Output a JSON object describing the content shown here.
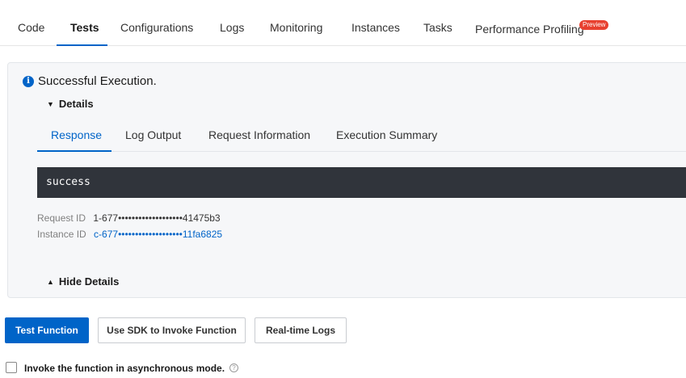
{
  "top_tabs": {
    "items": [
      "Code",
      "Tests",
      "Configurations",
      "Logs",
      "Monitoring",
      "Instances",
      "Tasks",
      "Performance Profiling"
    ],
    "active": "Tests",
    "preview_badge": "Preview"
  },
  "result": {
    "title": "Successful Execution.",
    "details_label": "Details",
    "sub_tabs": [
      "Response",
      "Log Output",
      "Request Information",
      "Execution Summary"
    ],
    "active_sub_tab": "Response",
    "response_body": "success",
    "request_id_label": "Request ID",
    "request_id_value": "1-677•••••••••••••••••••41475b3",
    "instance_id_label": "Instance ID",
    "instance_id_value": "c-677•••••••••••••••••••11fa6825",
    "hide_details_label": "Hide Details"
  },
  "actions": {
    "test_function": "Test Function",
    "sdk_invoke": "Use SDK to Invoke Function",
    "realtime_logs": "Real-time Logs"
  },
  "async": {
    "label": "Invoke the function in asynchronous mode.",
    "checked": false
  },
  "icons": {
    "info": "info-circle-icon",
    "caret_down": "caret-down-icon",
    "caret_up": "caret-up-icon",
    "help": "question-circle-icon"
  },
  "colors": {
    "accent": "#0064c8",
    "badge": "#e8402f",
    "response_bg": "#30343b"
  }
}
